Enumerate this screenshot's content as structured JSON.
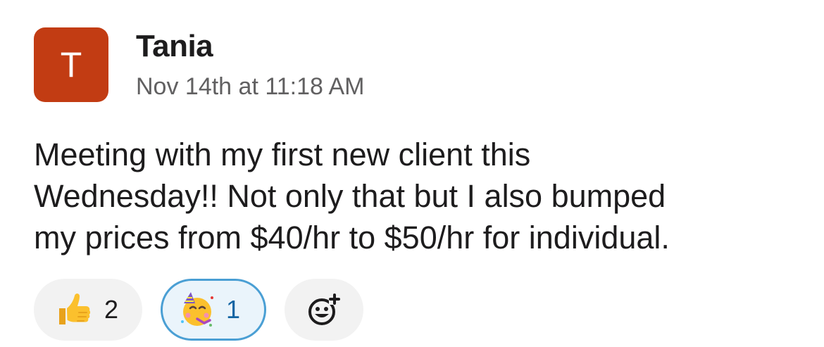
{
  "message": {
    "avatar_letter": "T",
    "author": "Tania",
    "timestamp": "Nov 14th at 11:18 AM",
    "text_lines": [
      "Meeting with my first new client this",
      "Wednesday!! Not only that but I also bumped",
      "my prices from $40/hr to $50/hr for individual."
    ]
  },
  "reactions": [
    {
      "emoji": "thumbs-up-icon",
      "count": "2",
      "selected": false
    },
    {
      "emoji": "partying-face-icon",
      "count": "1",
      "selected": true
    }
  ],
  "add_reaction": {
    "icon": "add-reaction-icon"
  },
  "colors": {
    "avatar": "#c23c13",
    "selected_border": "#4a9fd4",
    "selected_count": "#1264a3",
    "timestamp": "#616061"
  }
}
